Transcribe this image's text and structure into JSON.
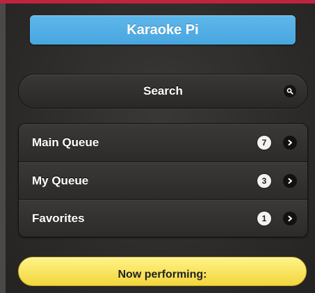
{
  "header": {
    "title": "Karaoke Pi"
  },
  "search": {
    "label": "Search",
    "icon": "search-icon"
  },
  "queues": [
    {
      "label": "Main Queue",
      "count": "7",
      "icon": "chevron-right-icon"
    },
    {
      "label": "My Queue",
      "count": "3",
      "icon": "chevron-right-icon"
    },
    {
      "label": "Favorites",
      "count": "1",
      "icon": "chevron-right-icon"
    }
  ],
  "now_performing": {
    "label": "Now performing:"
  },
  "colors": {
    "accent_bar": "#c0233f",
    "title_button": "#48a6e0",
    "now_performing": "#f3d63e",
    "background": "#2a2826"
  }
}
